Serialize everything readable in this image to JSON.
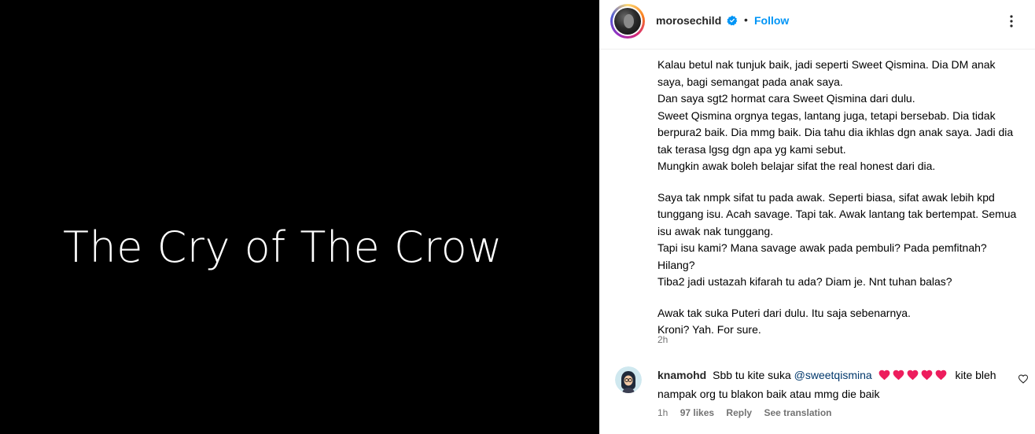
{
  "media": {
    "title": "The Cry of The Crow"
  },
  "header": {
    "username": "morosechild",
    "separator": "•",
    "follow_label": "Follow"
  },
  "caption": {
    "paragraphs": [
      "Kalau betul nak tunjuk baik, jadi seperti Sweet Qismina. Dia DM anak saya, bagi semangat pada anak saya.\nDan saya sgt2 hormat cara Sweet Qismina dari dulu.\nSweet Qismina orgnya tegas, lantang juga, tetapi bersebab. Dia tidak berpura2 baik. Dia mmg baik. Dia tahu dia ikhlas dgn anak saya. Jadi dia tak terasa lgsg dgn apa yg kami sebut.\nMungkin awak boleh belajar sifat the real honest dari dia.",
      "Saya tak nmpk sifat tu pada awak. Seperti biasa, sifat awak lebih kpd tunggang isu. Acah savage. Tapi tak. Awak lantang tak bertempat. Semua isu awak nak tunggang.\nTapi isu kami? Mana savage awak pada pembuli? Pada pemfitnah? Hilang?\nTiba2 jadi ustazah kifarah tu ada? Diam je. Nnt tuhan balas?",
      "Awak tak suka Puteri dari dulu. Itu saja sebenarnya.\nKroni? Yah. For sure."
    ],
    "time": "2h"
  },
  "comment": {
    "username": "knamohd",
    "text_before": "Sbb tu kite suka",
    "mention": "@sweetqismina",
    "heart_count": 5,
    "text_after": "kite bleh nampak org tu blakon baik atau mmg die baik",
    "time": "1h",
    "likes": "97 likes",
    "reply_label": "Reply",
    "translate_label": "See translation"
  },
  "colors": {
    "accent": "#0095f6",
    "mention": "#00376b",
    "heart": "#ed1d5d",
    "muted": "#737373"
  },
  "icons": {
    "verified": "verified-badge-icon",
    "more": "more-options-icon",
    "like": "heart-outline-icon",
    "emoji": "heart-emoji-icon"
  }
}
